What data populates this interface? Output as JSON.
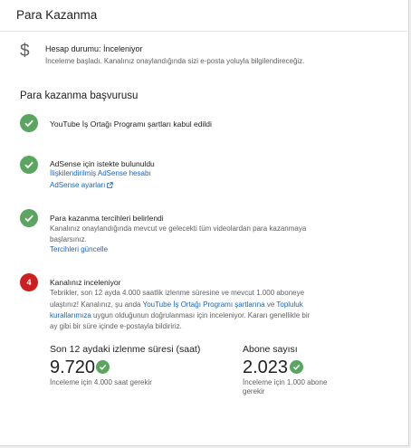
{
  "page": {
    "title": "Para Kazanma"
  },
  "status": {
    "icon": "dollar-icon",
    "title": "Hesap durumu: İnceleniyor",
    "description": "İnceleme başladı. Kanalınız onaylandığında sizi e-posta yoluyla bilgilendireceğiz."
  },
  "application": {
    "title": "Para kazanma başvurusu",
    "steps": [
      {
        "title": "YouTube İş Ortağı Programı şartları kabul edildi"
      },
      {
        "title": "AdSense için istekte bulunuldu",
        "link1": "İlişkilendirilmiş AdSense hesabı",
        "link2": "AdSense ayarları"
      },
      {
        "title": "Para kazanma tercihleri belirlendi",
        "text": "Kanalınız onaylandığında mevcut ve gelecekti tüm videolardan para kazanmaya başlarsınız.",
        "text_l1": "Kanalınız onaylandığında mevcut ve gelecekti tüm videolardan para kazanmaya",
        "text_l2": "başlarsınız.",
        "link": "Tercihleri güncelle"
      },
      {
        "number": "4",
        "title": "Kanalınız inceleniyor",
        "line1": "Tebrikler, son 12 ayda 4.000 saatlik izlenme süresine ve mevcut 1.000 aboneye",
        "line2_a": "ulaştınız! Kanalınız, şu anda ",
        "line2_link1": "YouTube İş Ortağı Programı şartlarına",
        "line2_b": " ve ",
        "line2_link2": "Topluluk",
        "line3_link": "kurallarımıza",
        "line3_b": " uygun olduğunun doğrulanması için inceleniyor. Kararı genellikle bir",
        "line4": "ay gibi bir süre içinde e-postayla bildiririz."
      }
    ]
  },
  "stats": {
    "watch_time": {
      "label": "Son 12 aydaki izlenme süresi (saat)",
      "value": "9.720",
      "note": "İnceleme için 4.000 saat gerekir"
    },
    "subscribers": {
      "label": "Abone sayısı",
      "value": "2.023",
      "note_l1": "İnceleme için 1.000 abone",
      "note_l2": "gerekir"
    }
  },
  "colors": {
    "success": "#5aa55f",
    "alert": "#cc1f1f",
    "link": "#1a63c4"
  }
}
